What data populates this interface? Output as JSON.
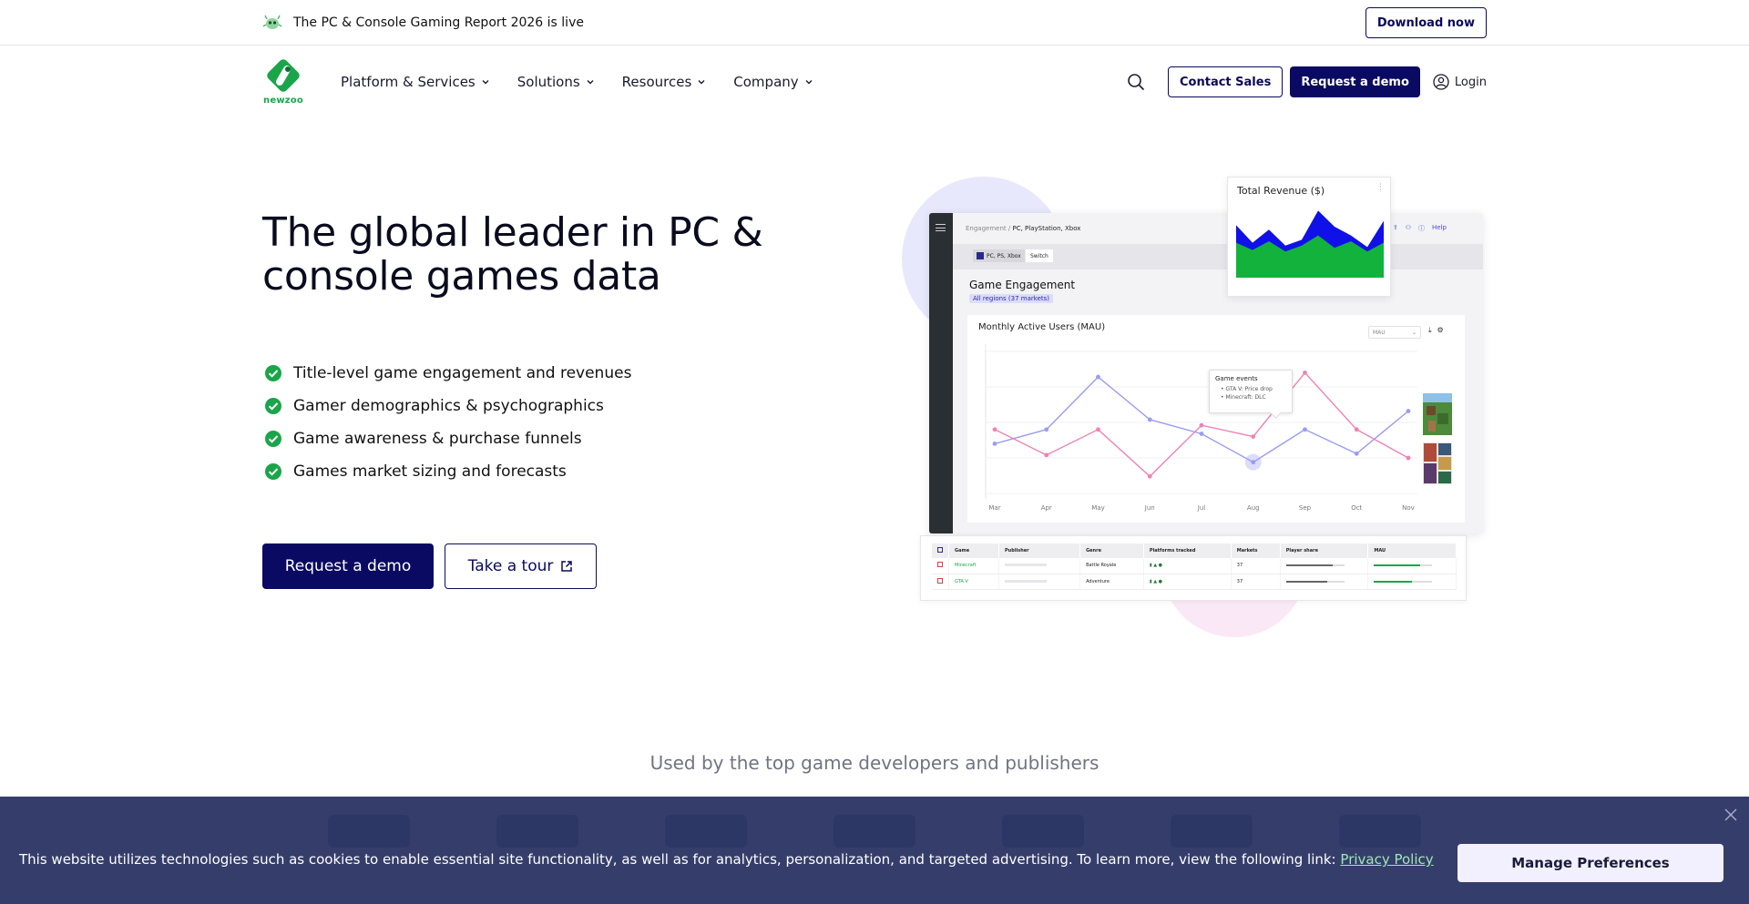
{
  "announcement": {
    "message": "The PC & Console Gaming Report 2026 is live",
    "button": "Download now"
  },
  "nav": {
    "logo_text": "newzoo",
    "menu": [
      {
        "label": "Platform & Services"
      },
      {
        "label": "Solutions"
      },
      {
        "label": "Resources"
      },
      {
        "label": "Company"
      }
    ],
    "contact_sales": "Contact Sales",
    "request_demo": "Request a demo",
    "login": "Login"
  },
  "hero": {
    "title": "The global leader in PC & console games data",
    "features": [
      "Title-level game engagement and revenues",
      "Gamer demographics & psychographics",
      "Game awareness & purchase funnels",
      "Games market sizing and forecasts"
    ],
    "cta_primary": "Request a demo",
    "cta_secondary": "Take a tour"
  },
  "dashboard": {
    "breadcrumb_parent": "Engagement",
    "breadcrumb_sep": "/",
    "breadcrumb_current": "PC, PlayStation, Xbox",
    "help": "Help",
    "platform_pill": "PC, PS, Xbox",
    "switch_pill": "Switch",
    "section_title": "Game Engagement",
    "regions_badge": "All regions (37 markets)",
    "chart_title": "Monthly Active Users (MAU)",
    "metric_select": "MAU",
    "tooltip": {
      "title": "Game events",
      "events": [
        "GTA V: Price drop",
        "Minecraft: DLC"
      ]
    },
    "revenue_title": "Total Revenue ($)",
    "table": {
      "headers": [
        "Game",
        "Publisher",
        "Genre",
        "Platforms tracked",
        "Markets",
        "Player share",
        "MAU"
      ],
      "rows": [
        {
          "game": "Minecraft",
          "genre": "Battle Royale",
          "markets": "37",
          "share": 0.8,
          "mau": 0.8
        },
        {
          "game": "GTA V",
          "genre": "Adventure",
          "markets": "37",
          "share": 0.7,
          "mau": 0.65
        }
      ]
    },
    "colors": {
      "blue_series": "#9b9cf0",
      "pink_series": "#ef82b4",
      "revenue_blue": "#1010e8",
      "revenue_green": "#12b23c"
    }
  },
  "chart_data": [
    {
      "type": "line",
      "title": "Monthly Active Users (MAU)",
      "categories": [
        "Mar",
        "Apr",
        "May",
        "Jun",
        "Jul",
        "Aug",
        "Sep",
        "Oct",
        "Nov"
      ],
      "series": [
        {
          "values": [
            35,
            45,
            82,
            52,
            42,
            22,
            45,
            28,
            58
          ]
        },
        {
          "values": [
            45,
            27,
            45,
            12,
            48,
            40,
            85,
            45,
            25
          ]
        }
      ],
      "ylim": [
        0,
        100
      ],
      "grid": true
    },
    {
      "type": "area",
      "title": "Total Revenue ($)",
      "series": [
        {
          "values": [
            48,
            38,
            50,
            36,
            44,
            58,
            41,
            50,
            36,
            48
          ]
        },
        {
          "values": [
            72,
            48,
            66,
            44,
            52,
            92,
            70,
            58,
            42,
            78
          ]
        }
      ],
      "ylim": [
        0,
        100
      ]
    }
  ],
  "used_by": "Used by the top game developers and publishers",
  "cookie": {
    "text": "This website utilizes technologies such as cookies to enable essential site functionality, as well as for analytics, personalization, and targeted advertising. To learn more, view the following link:",
    "link": "Privacy Policy",
    "manage": "Manage Preferences"
  }
}
